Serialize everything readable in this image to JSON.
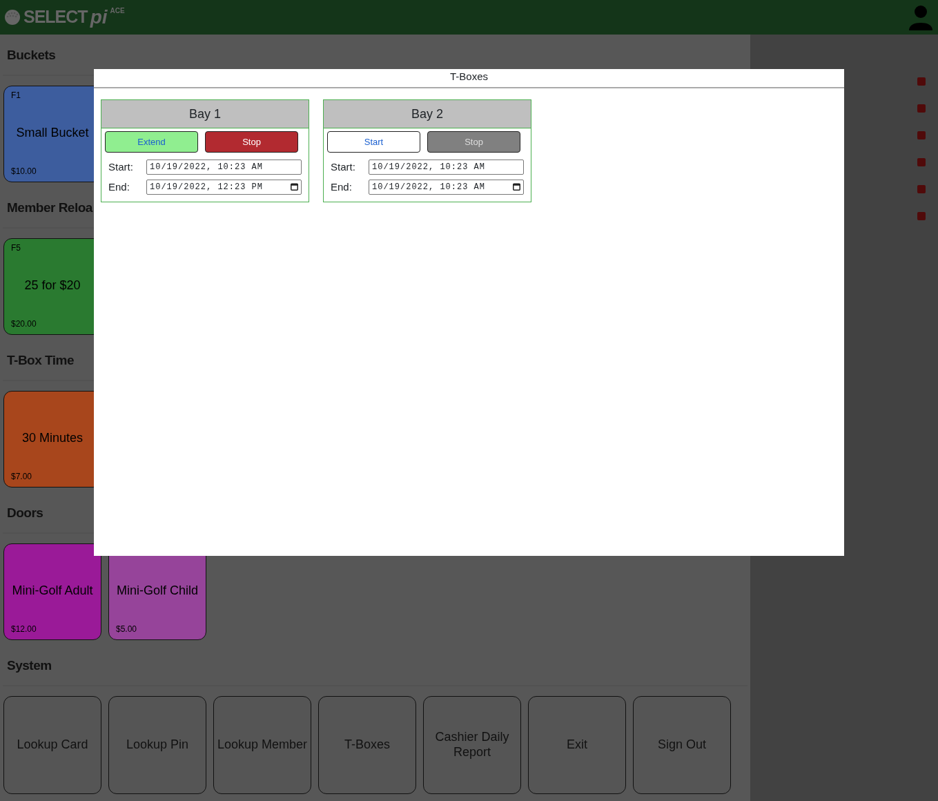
{
  "header": {
    "logo": {
      "brand": "SELECT",
      "suffix": "pi",
      "tag": "ACE"
    }
  },
  "sections": [
    {
      "title": "Buckets",
      "tiles": [
        {
          "hotkey": "F1",
          "name": "Small Bucket",
          "price": "$10.00",
          "color": "#3d5d9e"
        }
      ]
    },
    {
      "title": "Member Reloa",
      "tiles": [
        {
          "hotkey": "F5",
          "name": "25 for $20",
          "price": "$20.00",
          "color": "#2a7a30"
        }
      ]
    },
    {
      "title": "T-Box Time",
      "tiles": [
        {
          "name": "30 Minutes",
          "price": "$7.00",
          "color": "#a8461c"
        }
      ]
    },
    {
      "title": "Doors",
      "tiles": [
        {
          "name": "Mini-Golf Adult",
          "price": "$12.00",
          "color": "#9a1a98"
        },
        {
          "name": "Mini-Golf Child",
          "price": "$5.00",
          "color": "#96449a"
        }
      ]
    }
  ],
  "system": {
    "title": "System",
    "buttons": [
      "Lookup Card",
      "Lookup Pin",
      "Lookup Member",
      "T-Boxes",
      "Cashier Daily Report",
      "Exit",
      "Sign Out"
    ]
  },
  "modal": {
    "title": "T-Boxes",
    "bays": [
      {
        "name": "Bay 1",
        "buttons": [
          {
            "label": "Extend",
            "kind": "extend",
            "disabled": false
          },
          {
            "label": "Stop",
            "kind": "stop",
            "disabled": false
          }
        ],
        "fields": [
          {
            "label": "Start:",
            "value": "10/19/2022, 10:23 AM",
            "picker": false
          },
          {
            "label": "End:",
            "value": "10/19/2022, 12:23 PM",
            "picker": true
          }
        ]
      },
      {
        "name": "Bay 2",
        "buttons": [
          {
            "label": "Start",
            "kind": "start",
            "disabled": false
          },
          {
            "label": "Stop",
            "kind": "stop",
            "disabled": true
          }
        ],
        "fields": [
          {
            "label": "Start:",
            "value": "10/19/2022, 10:23 AM",
            "picker": false
          },
          {
            "label": "End:",
            "value": "10/19/2022, 10:23 AM",
            "picker": true
          }
        ]
      }
    ]
  }
}
